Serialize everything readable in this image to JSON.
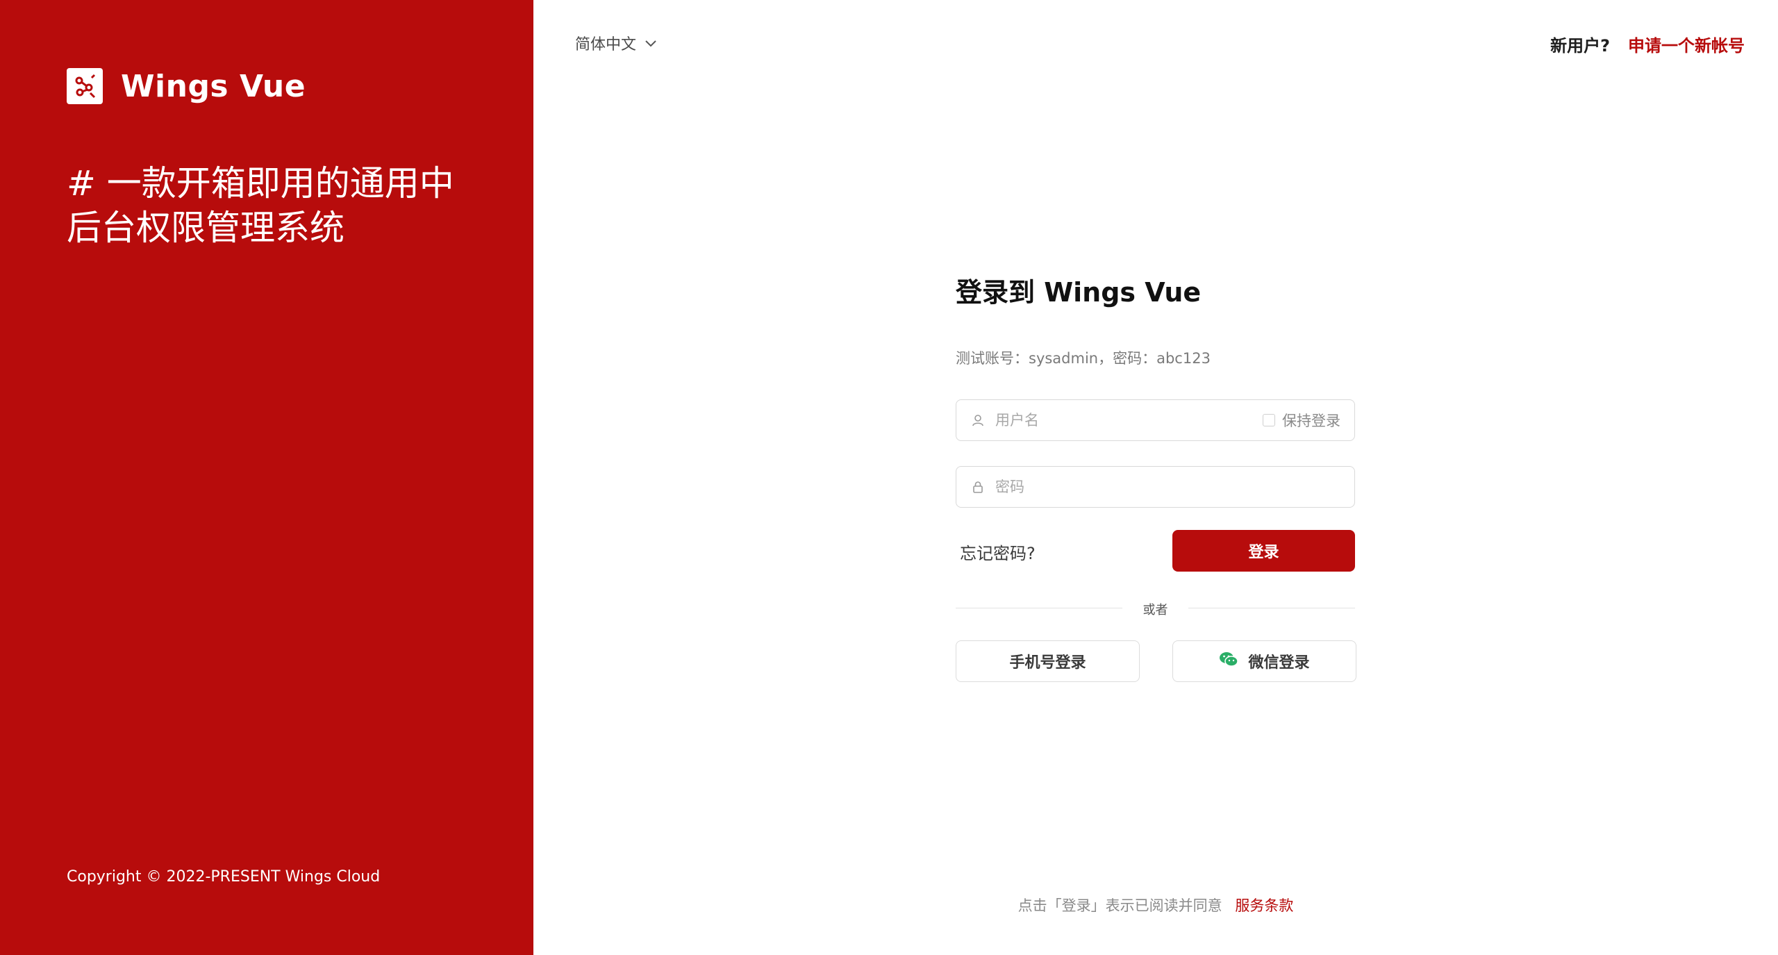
{
  "brand": {
    "name": "Wings Vue",
    "color": "#b70c0c"
  },
  "left_panel": {
    "tagline": "# 一款开箱即用的通用中后台权限管理系统",
    "copyright": "Copyright © 2022-PRESENT Wings Cloud"
  },
  "header": {
    "language": "简体中文",
    "new_user_label": "新用户?",
    "register_link": "申请一个新帐号"
  },
  "login": {
    "title": "登录到 Wings Vue",
    "test_account_hint": "测试账号：sysadmin，密码：abc123",
    "username_placeholder": "用户名",
    "remember_label": "保持登录",
    "password_placeholder": "密码",
    "forgot_password": "忘记密码?",
    "submit_label": "登录",
    "divider_text": "或者",
    "phone_login_label": "手机号登录",
    "wechat_login_label": "微信登录"
  },
  "footer": {
    "terms_prefix": "点击「登录」表示已阅读并同意",
    "terms_link": "服务条款"
  },
  "icons": {
    "logo": "logo-icon",
    "user": "user-icon",
    "lock": "lock-icon",
    "chevron": "chevron-down-icon",
    "wechat": "wechat-icon"
  }
}
